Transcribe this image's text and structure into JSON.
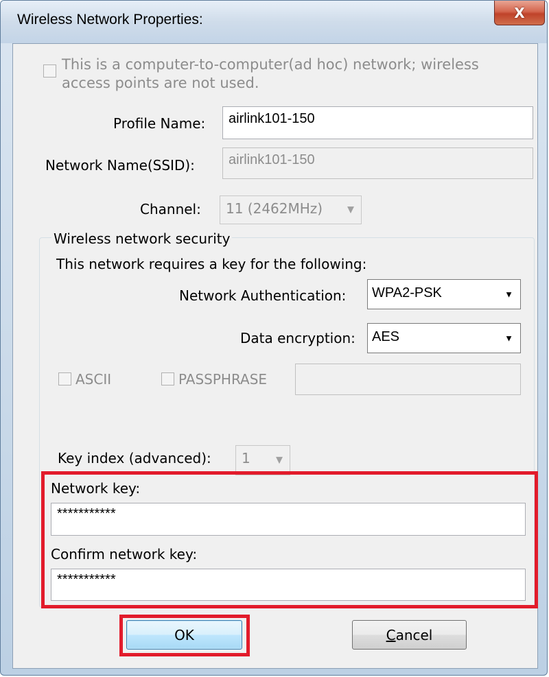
{
  "window": {
    "title": "Wireless Network Properties:",
    "close_glyph": "X"
  },
  "adhoc": {
    "label_line1": "This is a computer-to-computer(ad hoc) network; wireless",
    "label_line2": "access points are not used."
  },
  "profile": {
    "label": "Profile Name:",
    "value": "airlink101-150"
  },
  "ssid": {
    "label": "Network Name(SSID):",
    "value": "airlink101-150"
  },
  "channel": {
    "label": "Channel:",
    "value": "11 (2462MHz)"
  },
  "security": {
    "group_title": "Wireless network security",
    "requirement_text": "This network requires a key for the following:",
    "auth_label": "Network Authentication:",
    "auth_value": "WPA2-PSK",
    "encryption_label": "Data encryption:",
    "encryption_value": "AES",
    "ascii_label": "ASCII",
    "passphrase_label": "PASSPHRASE",
    "passphrase_value": "",
    "key_index_label": "Key index (advanced):",
    "key_index_value": "1",
    "network_key_label": "Network key:",
    "network_key_value": "***********",
    "confirm_key_label": "Confirm network key:",
    "confirm_key_value": "***********"
  },
  "buttons": {
    "ok": "OK",
    "cancel_first": "C",
    "cancel_rest": "ancel"
  },
  "colors": {
    "highlight": "#e21b2b",
    "dialog_background": "#f0f0f0",
    "default_button": "#bee6fd"
  },
  "icons": {
    "dropdown": "▼",
    "close": "close-icon"
  }
}
